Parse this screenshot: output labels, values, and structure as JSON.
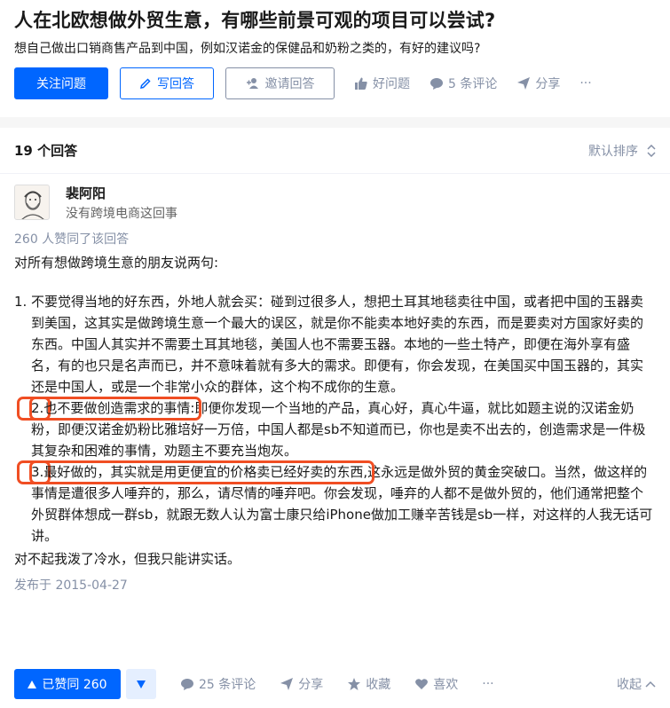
{
  "question": {
    "title": "人在北欧想做外贸生意，有哪些前景可观的项目可以尝试?",
    "detail": "想自己做出口销商售产品到中国，例如汉诺金的保健品和奶粉之类的，有好的建议吗?",
    "follow_label": "关注问题",
    "write_label": "写回答",
    "invite_label": "邀请回答",
    "good_question_label": "好问题",
    "comments_label": "5 条评论",
    "share_label": "分享",
    "more_label": "···"
  },
  "answers_header": {
    "count_label": "19 个回答",
    "sort_label": "默认排序"
  },
  "answer": {
    "author_name": "裴阿阳",
    "author_bio": "没有跨境电商这回事",
    "votes_line": "260 人赞同了该回答",
    "intro": "对所有想做跨境生意的朋友说两句:",
    "items": [
      {
        "num": "1.",
        "text": "不要觉得当地的好东西，外地人就会买：碰到过很多人，想把土耳其地毯卖往中国，或者把中国的玉器卖到美国，这其实是做跨境生意一个最大的误区，就是你不能卖本地好卖的东西，而是要卖对方国家好卖的东西。中国人其实并不需要土耳其地毯，美国人也不需要玉器。本地的一些土特产，即便在海外享有盛名，有的也只是名声而已，并不意味着就有多大的需求。即便有，你会发现，在美国买中国玉器的，其实还是中国人，或是一个非常小众的群体，这个构不成你的生意。"
      },
      {
        "num": "2.",
        "highlight": "也不要做创造需求的事情:",
        "text": "即便你发现一个当地的产品，真心好，真心牛逼，就比如题主说的汉诺金奶粉，即便汉诺金奶粉比雅培好一万倍，中国人都是sb不知道而已，你也是卖不出去的，创造需求是一件极其复杂和困难的事情，劝题主不要充当炮灰。"
      },
      {
        "num": "3.",
        "highlight": "最好做的，其实就是用更便宜的价格卖已经好卖的东西,",
        "text": "这永远是做外贸的黄金突破口。当然，做这样的事情是遭很多人唾弃的，那么，请尽情的唾弃吧。你会发现，唾弃的人都不是做外贸的，他们通常把整个外贸群体想成一群sb，就跟无数人认为富士康只给iPhone做加工赚辛苦钱是sb一样，对这样的人我无话可讲。"
      }
    ],
    "closing": "对不起我泼了冷水，但我只能讲实话。",
    "published": "发布于 2015-04-27",
    "vote_label": "已赞同 260",
    "comments_label": "25 条评论",
    "share_label": "分享",
    "favorite_label": "收藏",
    "like_label": "喜欢",
    "more_label": "···",
    "collapse_label": "收起"
  },
  "colors": {
    "primary": "#0066ff",
    "muted": "#8590a6",
    "highlight_box": "#f04e23"
  }
}
